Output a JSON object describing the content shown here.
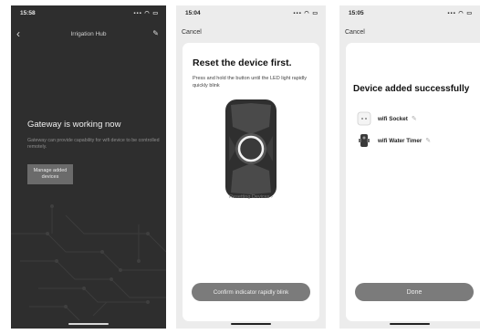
{
  "screen1": {
    "status_time": "15:58",
    "status_icons": "▪▪▪ ◠ ▭",
    "back_glyph": "‹",
    "nav_title": "Irrigation Hub",
    "edit_glyph": "✎",
    "heading": "Gateway is working now",
    "description": "Gateway can provide capability for wifi device to be controlled remotely.",
    "manage_button": "Manage added devices"
  },
  "screen2": {
    "status_time": "15:04",
    "status_icons": "▪▪▪ ◠ ▭",
    "cancel": "Cancel",
    "title": "Reset the device first.",
    "description": "Press and hold the button until the LED light rapidly quickly blink",
    "resetting_link": "Resetting Devices ›",
    "confirm_button": "Confirm indicator rapidly blink"
  },
  "screen3": {
    "status_time": "15:05",
    "status_icons": "▪▪▪ ◠ ▭",
    "cancel": "Cancel",
    "title": "Device added successfully",
    "devices": [
      {
        "name": "wifi Socket",
        "icon": "socket-icon"
      },
      {
        "name": "wifi Water Timer",
        "icon": "water-timer-icon"
      }
    ],
    "edit_glyph": "✎",
    "done_button": "Done"
  }
}
